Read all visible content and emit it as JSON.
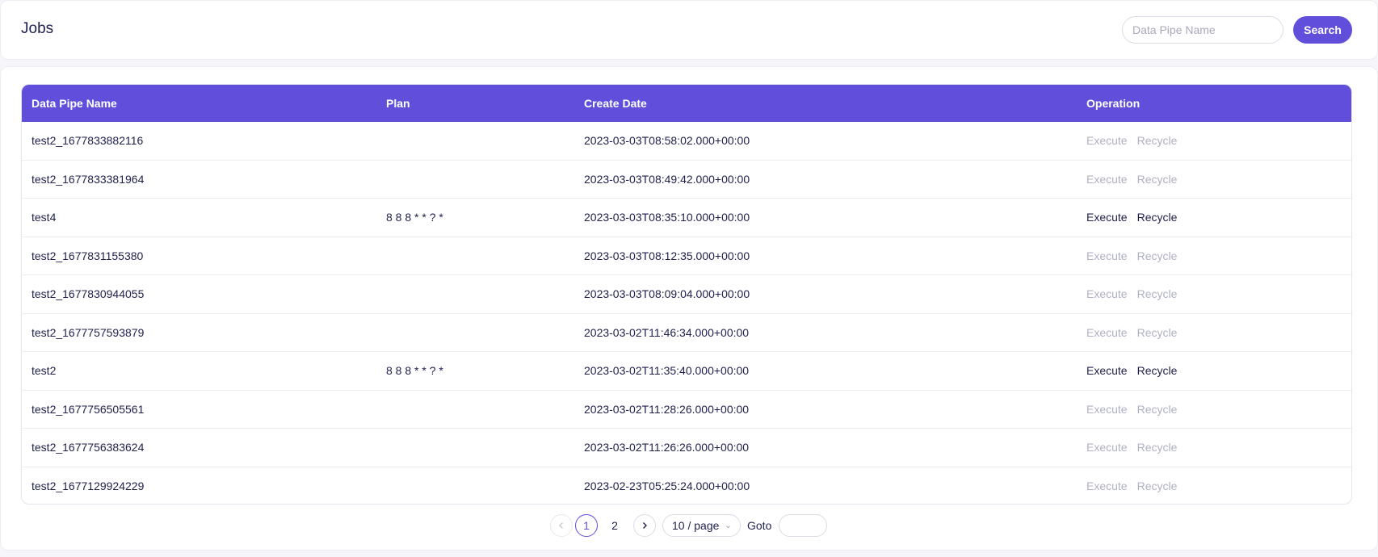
{
  "header": {
    "title": "Jobs",
    "search_placeholder": "Data Pipe Name",
    "search_value": "",
    "search_label": "Search"
  },
  "table": {
    "columns": [
      "Data Pipe Name",
      "Plan",
      "Create Date",
      "Operation"
    ],
    "rows": [
      {
        "name": "test2_1677833882116",
        "plan": "",
        "date": "2023-03-03T08:58:02.000+00:00",
        "enabled": false
      },
      {
        "name": "test2_1677833381964",
        "plan": "",
        "date": "2023-03-03T08:49:42.000+00:00",
        "enabled": false
      },
      {
        "name": "test4",
        "plan": "8 8 8 * * ? *",
        "date": "2023-03-03T08:35:10.000+00:00",
        "enabled": true
      },
      {
        "name": "test2_1677831155380",
        "plan": "",
        "date": "2023-03-03T08:12:35.000+00:00",
        "enabled": false
      },
      {
        "name": "test2_1677830944055",
        "plan": "",
        "date": "2023-03-03T08:09:04.000+00:00",
        "enabled": false
      },
      {
        "name": "test2_1677757593879",
        "plan": "",
        "date": "2023-03-02T11:46:34.000+00:00",
        "enabled": false
      },
      {
        "name": "test2",
        "plan": "8 8 8 * * ? *",
        "date": "2023-03-02T11:35:40.000+00:00",
        "enabled": true
      },
      {
        "name": "test2_1677756505561",
        "plan": "",
        "date": "2023-03-02T11:28:26.000+00:00",
        "enabled": false
      },
      {
        "name": "test2_1677756383624",
        "plan": "",
        "date": "2023-03-02T11:26:26.000+00:00",
        "enabled": false
      },
      {
        "name": "test2_1677129924229",
        "plan": "",
        "date": "2023-02-23T05:25:24.000+00:00",
        "enabled": false
      }
    ],
    "execute_label": "Execute",
    "recycle_label": "Recycle"
  },
  "pagination": {
    "prev_icon": "chevron-left-icon",
    "next_icon": "chevron-right-icon",
    "pages": [
      "1",
      "2"
    ],
    "current_page": "1",
    "page_size": "10 / page",
    "goto_label": "Goto",
    "goto_value": ""
  },
  "colors": {
    "accent": "#614fdc",
    "disabled_text": "#b0b0c4",
    "text": "#1f1f4d"
  }
}
